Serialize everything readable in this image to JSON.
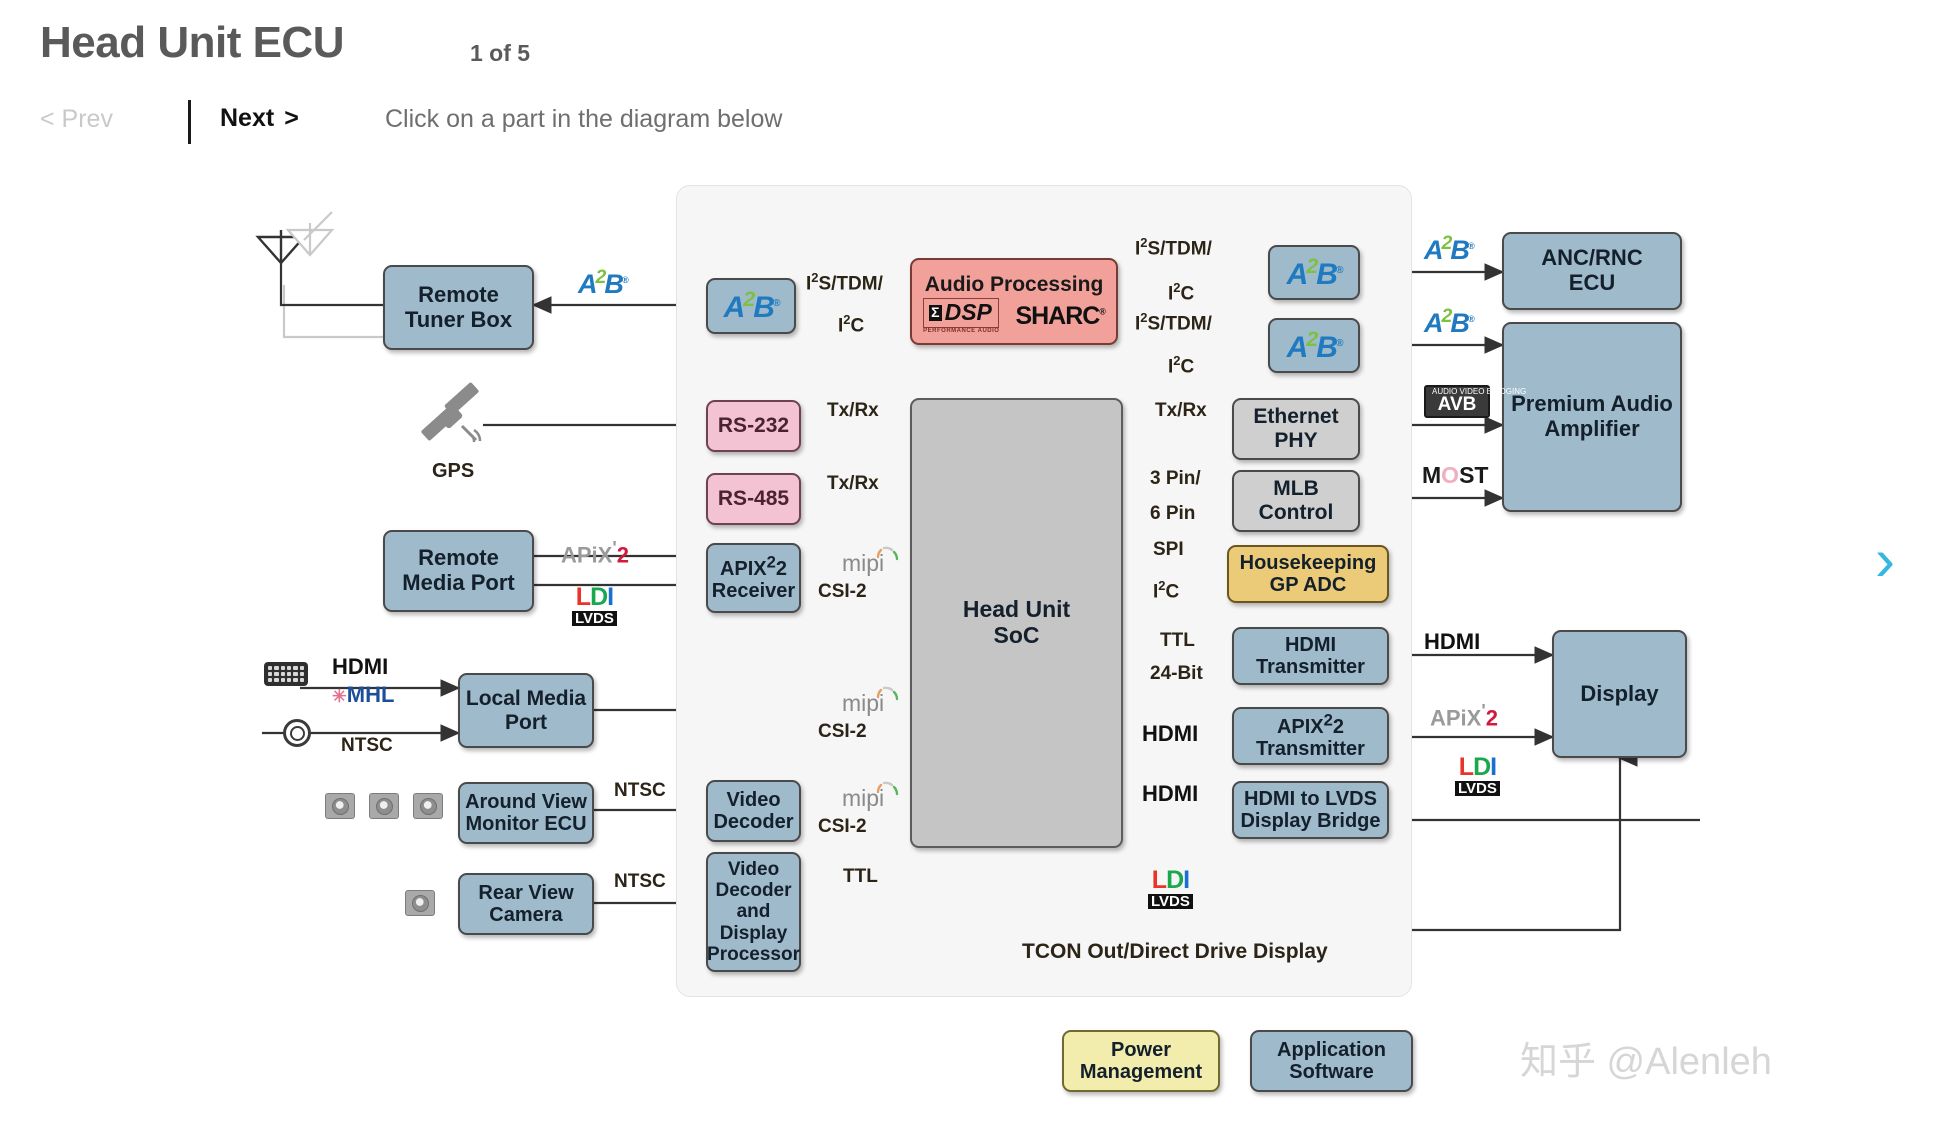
{
  "header": {
    "title": "Head Unit ECU",
    "counter": "1 of 5",
    "prev_label": "< Prev",
    "next_label": "Next",
    "next_chevron": ">",
    "hint": "Click on a part in the diagram below",
    "next_page_chevron": "›"
  },
  "watermark": "知乎 @Alenleh",
  "nodes": {
    "remote_tuner_box": "Remote\nTuner Box",
    "a2b_tuner": "A2B",
    "audio_processing": "Audio Processing",
    "a2b_anc": "A2B",
    "a2b_amp": "A2B",
    "anc_rnc_ecu": "ANC/RNC\nECU",
    "premium_audio_amplifier": "Premium Audio\nAmplifier",
    "rs232": "RS-232",
    "rs485": "RS-485",
    "ethernet_phy": "Ethernet\nPHY",
    "mlb_control": "MLB\nControl",
    "housekeeping_gp_adc": "Housekeeping\nGP ADC",
    "apix2_receiver": "APIX²2\nReceiver",
    "remote_media_port": "Remote\nMedia Port",
    "local_media_port": "Local Media\nPort",
    "around_view_monitor_ecu": "Around View\nMonitor ECU",
    "rear_view_camera": "Rear View\nCamera",
    "video_decoder": "Video\nDecoder",
    "video_decoder_display_processor": "Video\nDecoder\nand Display\nProcessor",
    "head_unit_soc": "Head Unit\nSoC",
    "hdmi_transmitter": "HDMI\nTransmitter",
    "apix2_transmitter": "APIX²2\nTransmitter",
    "hdmi_to_lvds_display_bridge": "HDMI to LVDS\nDisplay Bridge",
    "display": "Display",
    "power_management": "Power\nManagement",
    "application_software": "Application\nSoftware",
    "gps": "GPS",
    "tcon_note": "TCON Out/Direct Drive Display"
  },
  "node_lines": {
    "remote_tuner_box": [
      "Remote",
      "Tuner Box"
    ],
    "anc_rnc_ecu": [
      "ANC/RNC",
      "ECU"
    ],
    "premium_audio_amplifier": [
      "Premium Audio",
      "Amplifier"
    ],
    "ethernet_phy": [
      "Ethernet",
      "PHY"
    ],
    "mlb_control": [
      "MLB",
      "Control"
    ],
    "housekeeping_gp_adc": [
      "Housekeeping",
      "GP ADC"
    ],
    "apix2_receiver": [
      "APIX²2",
      "Receiver"
    ],
    "remote_media_port": [
      "Remote",
      "Media Port"
    ],
    "local_media_port": [
      "Local Media",
      "Port"
    ],
    "around_view_monitor_ecu": [
      "Around View",
      "Monitor ECU"
    ],
    "rear_view_camera": [
      "Rear View",
      "Camera"
    ],
    "video_decoder": [
      "Video",
      "Decoder"
    ],
    "video_decoder_display_processor": [
      "Video",
      "Decoder",
      "and Display",
      "Processor"
    ],
    "head_unit_soc": [
      "Head Unit",
      "SoC"
    ],
    "hdmi_transmitter": [
      "HDMI",
      "Transmitter"
    ],
    "apix2_transmitter": [
      "APIX²2",
      "Transmitter"
    ],
    "hdmi_to_lvds_display_bridge": [
      "HDMI to LVDS",
      "Display Bridge"
    ],
    "power_management": [
      "Power",
      "Management"
    ],
    "application_software": [
      "Application",
      "Software"
    ]
  },
  "bus_labels": {
    "i2s_tdm_1": "I²S/TDM/",
    "i2c_1": "I²C",
    "i2s_tdm_2": "I²S/TDM/",
    "i2c_2": "I²C",
    "i2s_tdm_3": "I²S/TDM/",
    "i2c_3": "I²C",
    "txrx_1": "Tx/Rx",
    "txrx_2": "Tx/Rx",
    "txrx_3": "Tx/Rx",
    "pin_3": "3 Pin/",
    "pin_6": "6 Pin",
    "spi": "SPI",
    "i2c_4": "I²C",
    "ttl_24bit_a": "TTL",
    "ttl_24bit_b": "24-Bit",
    "ttl_video": "TTL",
    "csi2_1": "CSI-2",
    "csi2_2": "CSI-2",
    "csi2_3": "CSI-2",
    "mipi_1": "mipi",
    "mipi_2": "mipi",
    "mipi_3": "mipi",
    "ntsc_1": "NTSC",
    "ntsc_2": "NTSC",
    "ntsc_3": "NTSC"
  },
  "logos": {
    "a2b": "A2B",
    "a2b_sup": "2",
    "apix": "APiX",
    "apix_sup": "2",
    "hdmi": "HDMI",
    "mhl": "MHL",
    "avb_top": "AUDIO VIDEO BRIDGING",
    "avb_bot": "AVB",
    "most": "MOST",
    "ldi_l": "L",
    "ldi_d": "D",
    "ldi_i": "I",
    "ldi_lvds": "LVDS",
    "mipi": "mipi",
    "dsp": "DSP",
    "dsp_sigma": "Σ",
    "dsp_sub": "PERFORMANCE AUDIO",
    "sharc": "SHARC"
  },
  "colors": {
    "blue_node": "#9fbacb",
    "pink_node": "#f4c3d3",
    "gray_node": "#cfcfcf",
    "salmon_node": "#f2a09a",
    "gold_node": "#eccb78",
    "yellow_node": "#f2edad",
    "soc_node": "#c5c5c5",
    "panel_bg": "#f6f6f6",
    "accent_chevron": "#37b7e0",
    "title_color": "#5a5a5a"
  }
}
